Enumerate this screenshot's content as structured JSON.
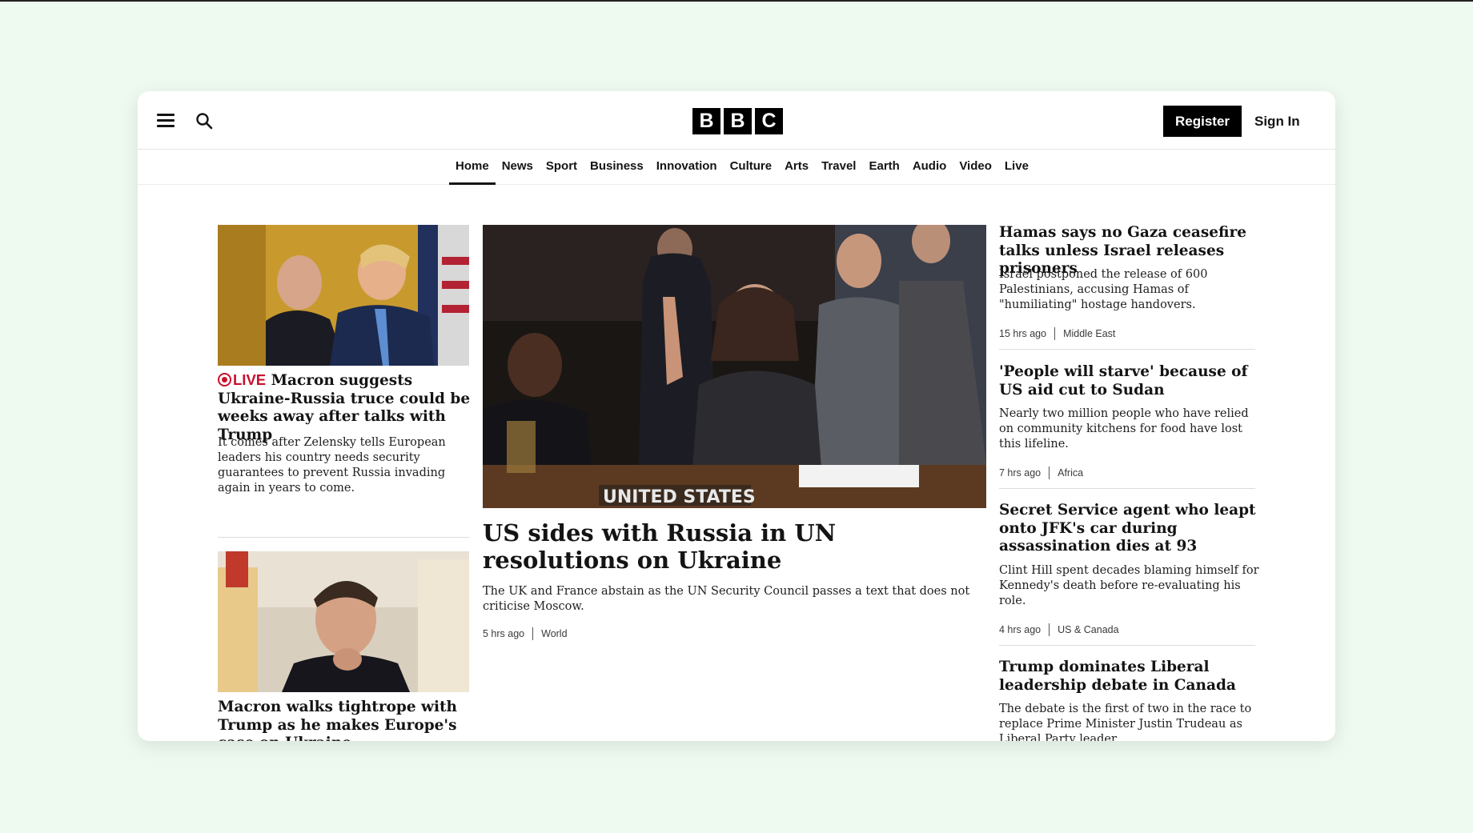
{
  "header": {
    "logo_letters": [
      "B",
      "B",
      "C"
    ],
    "register_label": "Register",
    "signin_label": "Sign In"
  },
  "nav": {
    "items": [
      "Home",
      "News",
      "Sport",
      "Business",
      "Innovation",
      "Culture",
      "Arts",
      "Travel",
      "Earth",
      "Audio",
      "Video",
      "Live"
    ],
    "active": "Home"
  },
  "left": {
    "story1": {
      "live_label": "LIVE",
      "headline": "Macron suggests Ukraine-Russia truce could be weeks away after talks with Trump",
      "summary": "It comes after Zelensky tells European leaders his country needs security guarantees to prevent Russia invading again in years to come."
    },
    "story2": {
      "headline": "Macron walks tightrope with Trump as he makes Europe's case on Ukraine"
    }
  },
  "center": {
    "image_caption_text": "UNITED STATES",
    "headline": "US sides with Russia in UN resolutions on Ukraine",
    "summary": "The UK and France abstain as the UN Security Council passes a text that does not criticise Moscow.",
    "time": "5 hrs ago",
    "section": "World"
  },
  "right": [
    {
      "headline": "Hamas says no Gaza ceasefire talks unless Israel releases prisoners",
      "summary": "Israel postponed the release of 600 Palestinians, accusing Hamas of \"humiliating\" hostage handovers.",
      "time": "15 hrs ago",
      "section": "Middle East"
    },
    {
      "headline": "'People will starve' because of US aid cut to Sudan",
      "summary": "Nearly two million people who have relied on community kitchens for food have lost this lifeline.",
      "time": "7 hrs ago",
      "section": "Africa"
    },
    {
      "headline": "Secret Service agent who leapt onto JFK's car during assassination dies at 93",
      "summary": "Clint Hill spent decades blaming himself for Kennedy's death before re-evaluating his role.",
      "time": "4 hrs ago",
      "section": "US & Canada"
    },
    {
      "headline": "Trump dominates Liberal leadership debate in Canada",
      "summary": "The debate is the first of two in the race to replace Prime Minister Justin Trudeau as Liberal Party leader.",
      "time": "",
      "section": ""
    }
  ]
}
